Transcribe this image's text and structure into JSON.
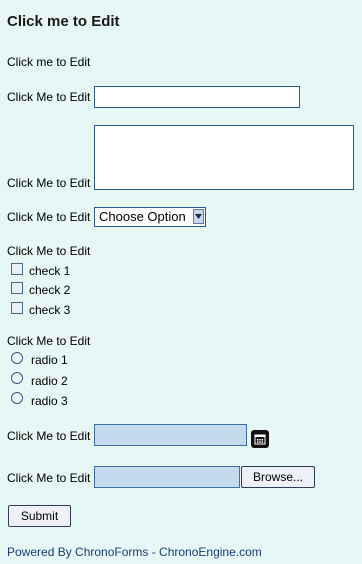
{
  "form": {
    "title": "Click me to Edit",
    "text_label": "Click me to Edit",
    "textbox": {
      "label": "Click Me to Edit",
      "value": ""
    },
    "textarea": {
      "label": "Click Me to Edit",
      "value": ""
    },
    "dropdown": {
      "label": "Click Me to Edit",
      "selected": "Choose Option"
    },
    "checkbox_group": {
      "label": "Click Me to Edit",
      "items": [
        {
          "label": "check 1",
          "checked": false
        },
        {
          "label": "check 2",
          "checked": false
        },
        {
          "label": "check 3",
          "checked": false
        }
      ]
    },
    "radio_group": {
      "label": "Click Me to Edit",
      "items": [
        {
          "label": "radio 1",
          "selected": false
        },
        {
          "label": "radio 2",
          "selected": false
        },
        {
          "label": "radio 3",
          "selected": false
        }
      ]
    },
    "datetime": {
      "label": "Click Me to Edit",
      "value": "",
      "icon": "calendar-icon"
    },
    "file": {
      "label": "Click Me to Edit",
      "value": "",
      "browse_label": "Browse..."
    },
    "submit_label": "Submit"
  },
  "footer": {
    "text": "Powered By ChronoForms - ChronoEngine.com"
  },
  "colors": {
    "background": "#e6f7f5",
    "input_border": "#2a5a94",
    "filled_input": "#c4dbef",
    "footer_link": "#1d3b7a"
  }
}
